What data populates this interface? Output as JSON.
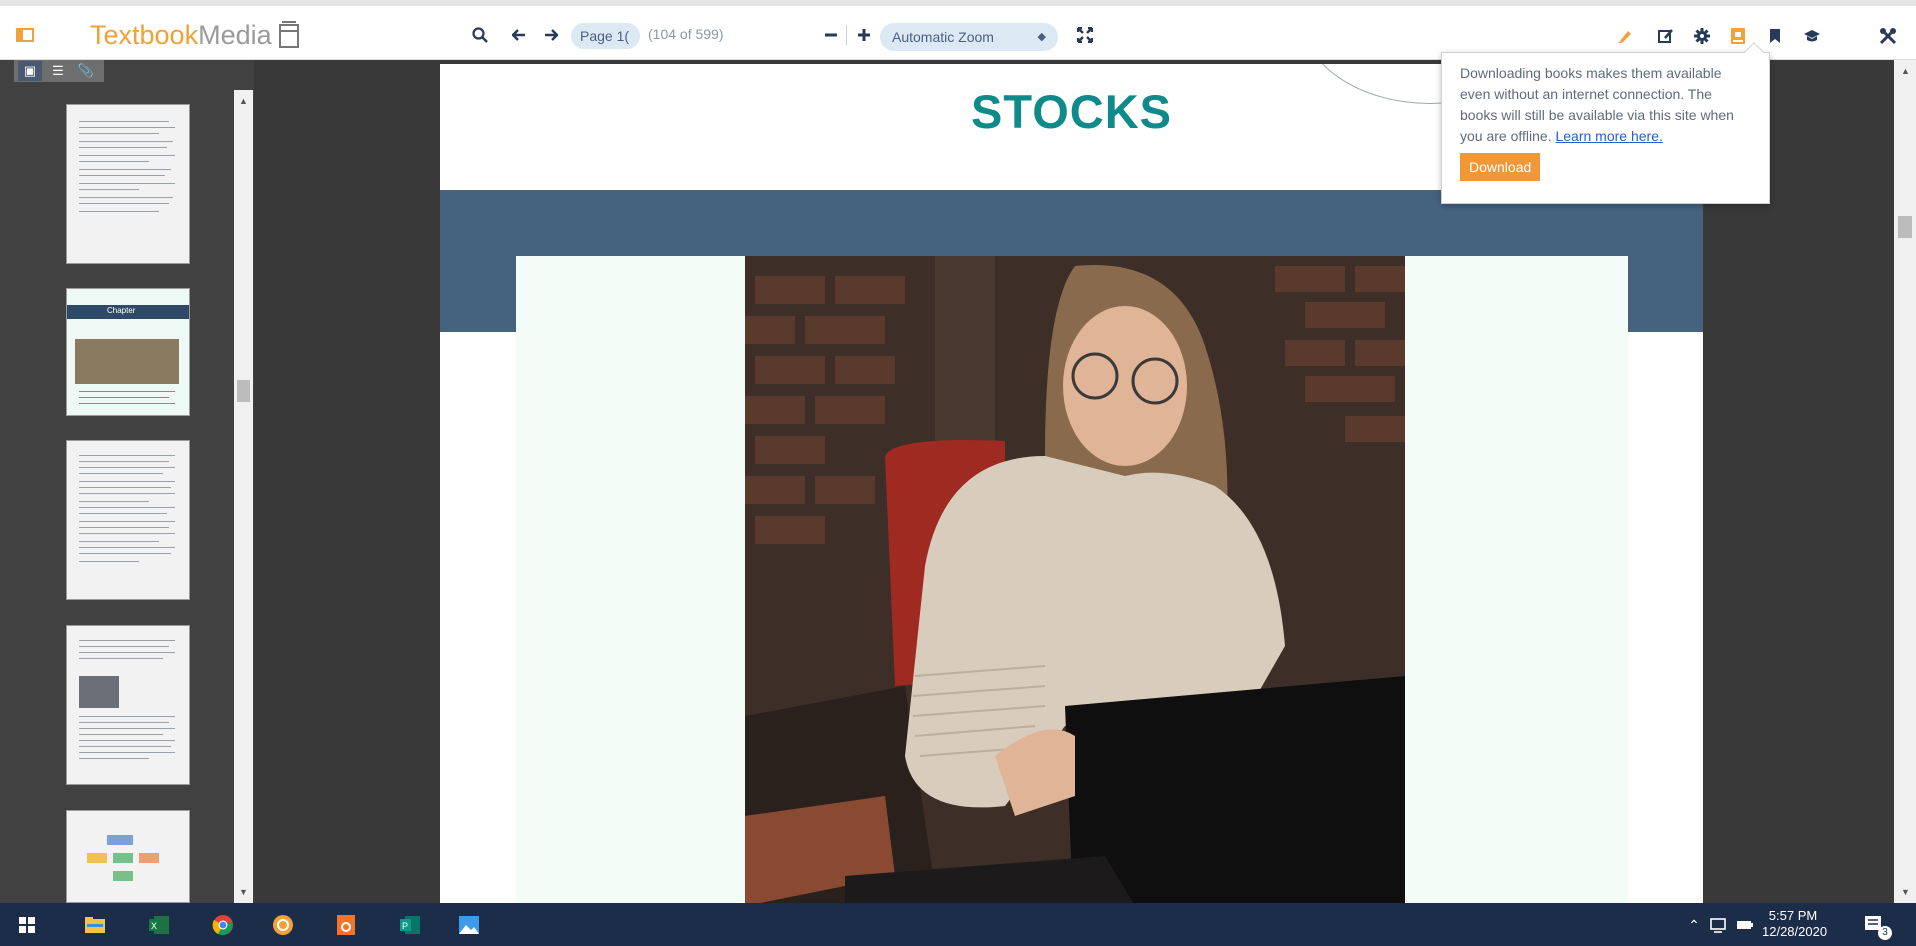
{
  "toolbar": {
    "brand_text_part1": "Textbook",
    "brand_text_part2": "Media",
    "page_input_value": "Page 1(",
    "page_count": "(104 of 599)",
    "zoom_value": "Automatic Zoom",
    "icons": [
      "sidebar-toggle-icon",
      "search-icon",
      "arrow-left-icon",
      "arrow-right-icon",
      "zoom-out-icon",
      "zoom-in-icon",
      "fullscreen-icon",
      "highlighter-icon",
      "edit-note-icon",
      "settings-gear-icon",
      "download-book-icon",
      "bookmark-icon",
      "graduation-cap-icon",
      "tools-icon"
    ],
    "accent_color": "#f0a13a"
  },
  "sidebar": {
    "tabs": [
      "thumbnails",
      "outline",
      "attachments"
    ],
    "thumbnails": [
      {
        "kind": "text-page"
      },
      {
        "kind": "chapter-page",
        "label": "Chapter"
      },
      {
        "kind": "text-page"
      },
      {
        "kind": "text-image-page"
      },
      {
        "kind": "diagram-page"
      }
    ]
  },
  "document": {
    "page_title": "STOCKS",
    "title_color": "#0f8a8a",
    "band_color": "#45627f"
  },
  "download_popup": {
    "text": "Downloading books makes them available even without an internet connection. The books will still be available via this site when you are offline.",
    "link_text": "Learn more here.",
    "button_label": "Download"
  },
  "taskbar": {
    "apps": [
      "windows-start-icon",
      "file-explorer-icon",
      "excel-icon",
      "chrome-icon",
      "orange-app-icon",
      "office-lens-icon",
      "publisher-icon",
      "photos-icon"
    ],
    "time": "5:57 PM",
    "date": "12/28/2020",
    "notification_count": "3"
  }
}
